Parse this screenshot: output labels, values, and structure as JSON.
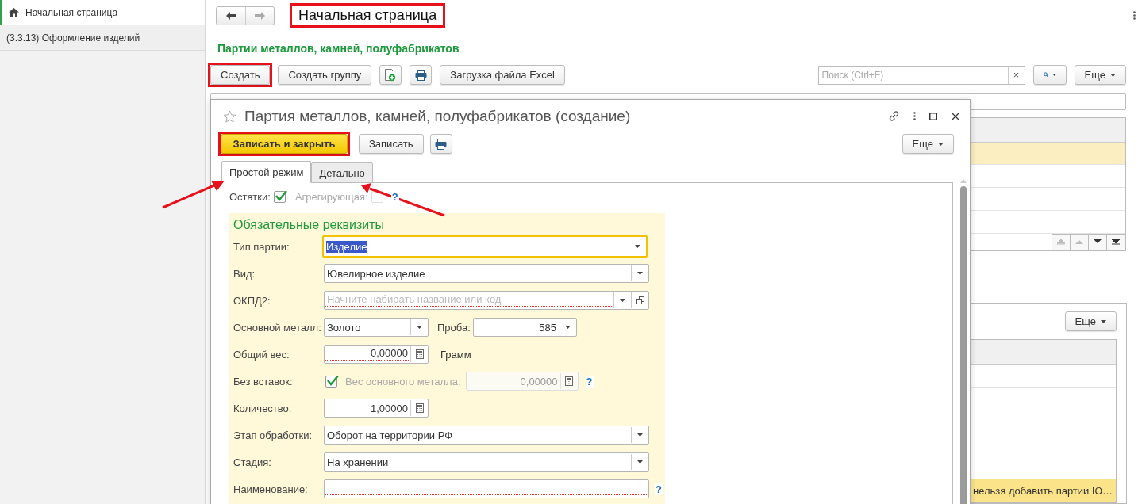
{
  "sidebar": {
    "items": [
      {
        "label": "Начальная страница",
        "selected": true
      },
      {
        "label": "(3.3.13) Оформление изделий",
        "selected": false
      }
    ]
  },
  "page": {
    "title": "Начальная страница",
    "title_annotated": true,
    "section_title": "Партии металлов, камней, полуфабрикатов",
    "toolbar": [
      {
        "kind": "text",
        "label": "Создать",
        "annotated": true
      },
      {
        "kind": "text",
        "label": "Создать группу",
        "annotated": false
      },
      {
        "kind": "add",
        "annotated": false
      },
      {
        "kind": "print",
        "annotated": false
      },
      {
        "kind": "text",
        "label": "Загрузка файла Excel",
        "annotated": false
      }
    ],
    "search": {
      "placeholder": "Поиск (Ctrl+F)",
      "clear": "×"
    },
    "more": "Еще",
    "upper_table": {
      "rows": [
        {
          "selected": true
        },
        {
          "selected": false
        },
        {
          "selected": false
        },
        {
          "selected": false
        }
      ]
    },
    "lower_table": {
      "more": "Еще",
      "rows": [
        {
          "selected": false
        },
        {
          "selected": false
        },
        {
          "selected": false
        },
        {
          "selected": false
        },
        {
          "selected": false
        },
        {
          "text": "нельзя добавить партии Ю…",
          "selected": true
        }
      ]
    }
  },
  "dialog": {
    "title": "Партия металлов, камней, полуфабрикатов (создание)",
    "buttons": [
      {
        "kind": "primary",
        "label": "Записать и закрыть",
        "annotated": true
      },
      {
        "kind": "default",
        "label": "Записать",
        "annotated": false
      },
      {
        "kind": "print",
        "annotated": false
      }
    ],
    "more": "Еще",
    "tabs": [
      {
        "label": "Простой режим",
        "selected": true
      },
      {
        "label": "Детально",
        "selected": false
      }
    ],
    "checks": [
      {
        "label": "Остатки:",
        "checked": true,
        "disabled": false
      },
      {
        "label": "Агрегирующая:",
        "checked": false,
        "disabled": true,
        "help": "?"
      }
    ],
    "group_title": "Обязательные реквизиты",
    "fields": [
      {
        "kind": "select",
        "label": "Тип партии:",
        "value": "Изделие",
        "focused": true
      },
      {
        "kind": "select",
        "label": "Вид:",
        "value": "Ювелирное изделие",
        "focused": false
      },
      {
        "kind": "lookup",
        "label": "ОКПД2:",
        "placeholder": "Начните набирать название или код",
        "required": true
      },
      {
        "kind": "pair",
        "label": "Основной металл:",
        "value": "Золото",
        "label2": "Проба:",
        "value2": "585"
      },
      {
        "kind": "number",
        "label": "Общий вес:",
        "value": "0,00000",
        "unit": "Грамм",
        "required": true
      },
      {
        "kind": "check",
        "label": "Без вставок:",
        "checked": true,
        "sub_label": "Вес основного металла:",
        "sub_value": "0,00000",
        "help": "?"
      },
      {
        "kind": "number",
        "label": "Количество:",
        "value": "1,00000",
        "required": false
      },
      {
        "kind": "select",
        "label": "Этап обработки:",
        "value": "Оборот на территории РФ",
        "focused": false
      },
      {
        "kind": "select",
        "label": "Стадия:",
        "value": "На хранении",
        "focused": false
      },
      {
        "kind": "text",
        "label": "Наименование:",
        "required": true,
        "help": "?"
      }
    ]
  }
}
